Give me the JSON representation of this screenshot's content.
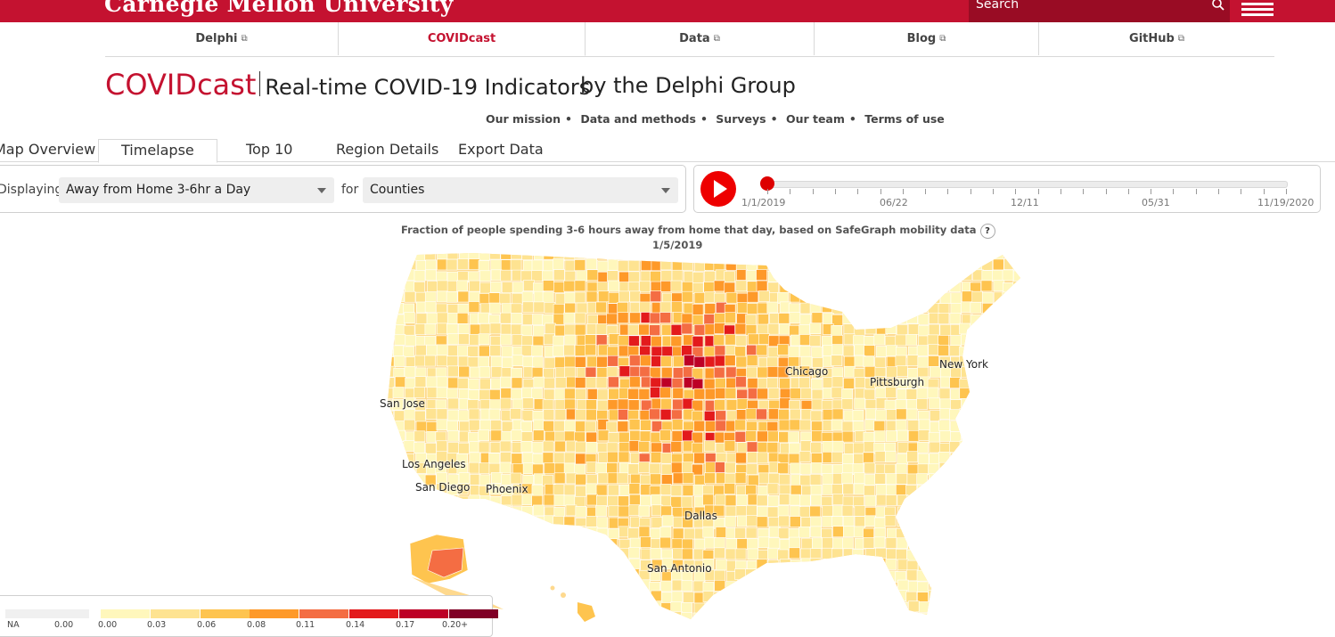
{
  "header": {
    "brand": "Carnegie Mellon University",
    "search_placeholder": "Search"
  },
  "nav": {
    "tabs": [
      {
        "label": "Delphi",
        "external": true
      },
      {
        "label": "COVIDcast",
        "external": false,
        "active": true
      },
      {
        "label": "Data",
        "external": true
      },
      {
        "label": "Blog",
        "external": true
      },
      {
        "label": "GitHub",
        "external": true
      }
    ]
  },
  "title": {
    "name": "COVIDcast",
    "subtitle": "Real-time COVID-19 Indicators",
    "byline": "by the Delphi Group"
  },
  "links": [
    "Our mission",
    "Data and methods",
    "Surveys",
    "Our team",
    "Terms of use"
  ],
  "view_tabs": [
    "Map Overview",
    "Timelapse",
    "Top 10",
    "Region Details",
    "Export Data"
  ],
  "active_view_tab": "Timelapse",
  "controls": {
    "displaying_label": "Displaying",
    "signal": "Away from Home 3-6hr a Day",
    "for_label": "for",
    "region": "Counties"
  },
  "timeline": {
    "start": "1/1/2019",
    "labels": [
      "1/1/2019",
      "06/22",
      "12/11",
      "05/31",
      "11/19/2020"
    ],
    "progress": 0.0
  },
  "map": {
    "title": "Fraction of people spending 3-6 hours away from home that day, based on SafeGraph mobility data",
    "help": "?",
    "date": "1/5/2019",
    "cities": [
      "San Jose",
      "Los Angeles",
      "San Diego",
      "Phoenix",
      "Dallas",
      "San Antonio",
      "Chicago",
      "Pittsburgh",
      "New York"
    ]
  },
  "legend": {
    "na_label": "NA",
    "labels": [
      "0.00",
      "0.00",
      "0.03",
      "0.06",
      "0.08",
      "0.11",
      "0.14",
      "0.17",
      "0.20+"
    ],
    "colors": [
      "#fff7bc",
      "#fee391",
      "#fec44f",
      "#fe9929",
      "#f46d43",
      "#e31a1c",
      "#bd0026",
      "#800026"
    ],
    "na_color": "#f0f0f0"
  }
}
